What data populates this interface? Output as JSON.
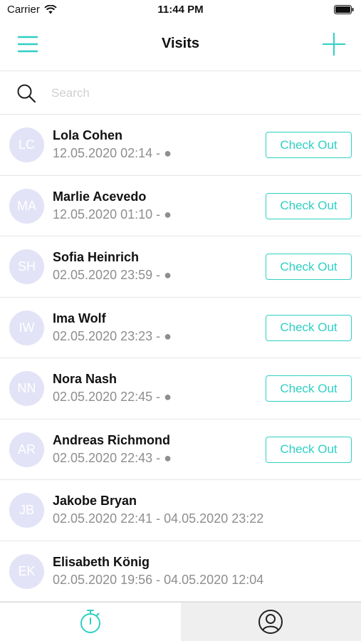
{
  "status_bar": {
    "carrier": "Carrier",
    "time": "11:44 PM"
  },
  "nav": {
    "title": "Visits"
  },
  "search": {
    "placeholder": "Search",
    "value": ""
  },
  "visits": [
    {
      "initials": "LC",
      "name": "Lola Cohen",
      "time": "12.05.2020 02:14 - ●",
      "button": "Check Out"
    },
    {
      "initials": "MA",
      "name": "Marlie Acevedo",
      "time": "12.05.2020 01:10 - ●",
      "button": "Check Out"
    },
    {
      "initials": "SH",
      "name": "Sofia Heinrich",
      "time": "02.05.2020 23:59 - ●",
      "button": "Check Out"
    },
    {
      "initials": "IW",
      "name": "Ima Wolf",
      "time": "02.05.2020 23:23 - ●",
      "button": "Check Out"
    },
    {
      "initials": "NN",
      "name": "Nora Nash",
      "time": "02.05.2020 22:45 - ●",
      "button": "Check Out"
    },
    {
      "initials": "AR",
      "name": "Andreas Richmond",
      "time": "02.05.2020 22:43 - ●",
      "button": "Check Out"
    },
    {
      "initials": "JB",
      "name": "Jakobe Bryan",
      "time": "02.05.2020 22:41 - 04.05.2020 23:22"
    },
    {
      "initials": "EK",
      "name": "Elisabeth König",
      "time": "02.05.2020 19:56 - 04.05.2020 12:04"
    }
  ],
  "tab_bar": {
    "tabs": [
      {
        "icon": "stopwatch-icon",
        "active": true
      },
      {
        "icon": "profile-icon",
        "active": false
      }
    ]
  },
  "colors": {
    "accent": "#2fd0c4",
    "avatar_bg": "#e3e3f7",
    "muted_text": "#8e8e8e"
  }
}
